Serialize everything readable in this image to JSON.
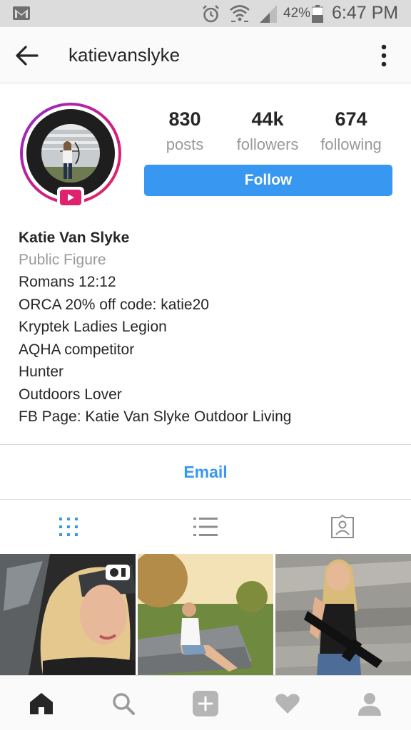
{
  "status_bar": {
    "battery": "42%",
    "time": "6:47 PM",
    "icons": [
      "gmail-icon",
      "alarm-icon",
      "wifi-icon",
      "signal-icon",
      "battery-icon"
    ]
  },
  "header": {
    "username": "katievanslyke",
    "back_icon": "arrow-left-icon",
    "more_icon": "more-vertical-icon"
  },
  "profile": {
    "stats": [
      {
        "value": "830",
        "label": "posts"
      },
      {
        "value": "44k",
        "label": "followers"
      },
      {
        "value": "674",
        "label": "following"
      }
    ],
    "follow_label": "Follow",
    "name": "Katie Van Slyke",
    "category": "Public Figure",
    "bio_lines": [
      "Romans 12:12",
      "ORCA 20% off code: katie20",
      "Kryptek Ladies Legion",
      "AQHA competitor",
      "Hunter",
      "Outdoors Lover",
      "FB Page: Katie Van Slyke Outdoor Living"
    ],
    "email_label": "Email"
  },
  "tabs": [
    {
      "icon": "grid-icon",
      "active": true
    },
    {
      "icon": "list-icon",
      "active": false
    },
    {
      "icon": "tagged-photos-icon",
      "active": false
    }
  ],
  "bottom_nav": [
    {
      "icon": "home-icon"
    },
    {
      "icon": "search-icon"
    },
    {
      "icon": "add-post-icon"
    },
    {
      "icon": "heart-icon"
    },
    {
      "icon": "profile-icon"
    }
  ],
  "colors": {
    "accent": "#3897f0",
    "text": "#262626",
    "muted": "#999999",
    "igtv": "#e0216e"
  }
}
